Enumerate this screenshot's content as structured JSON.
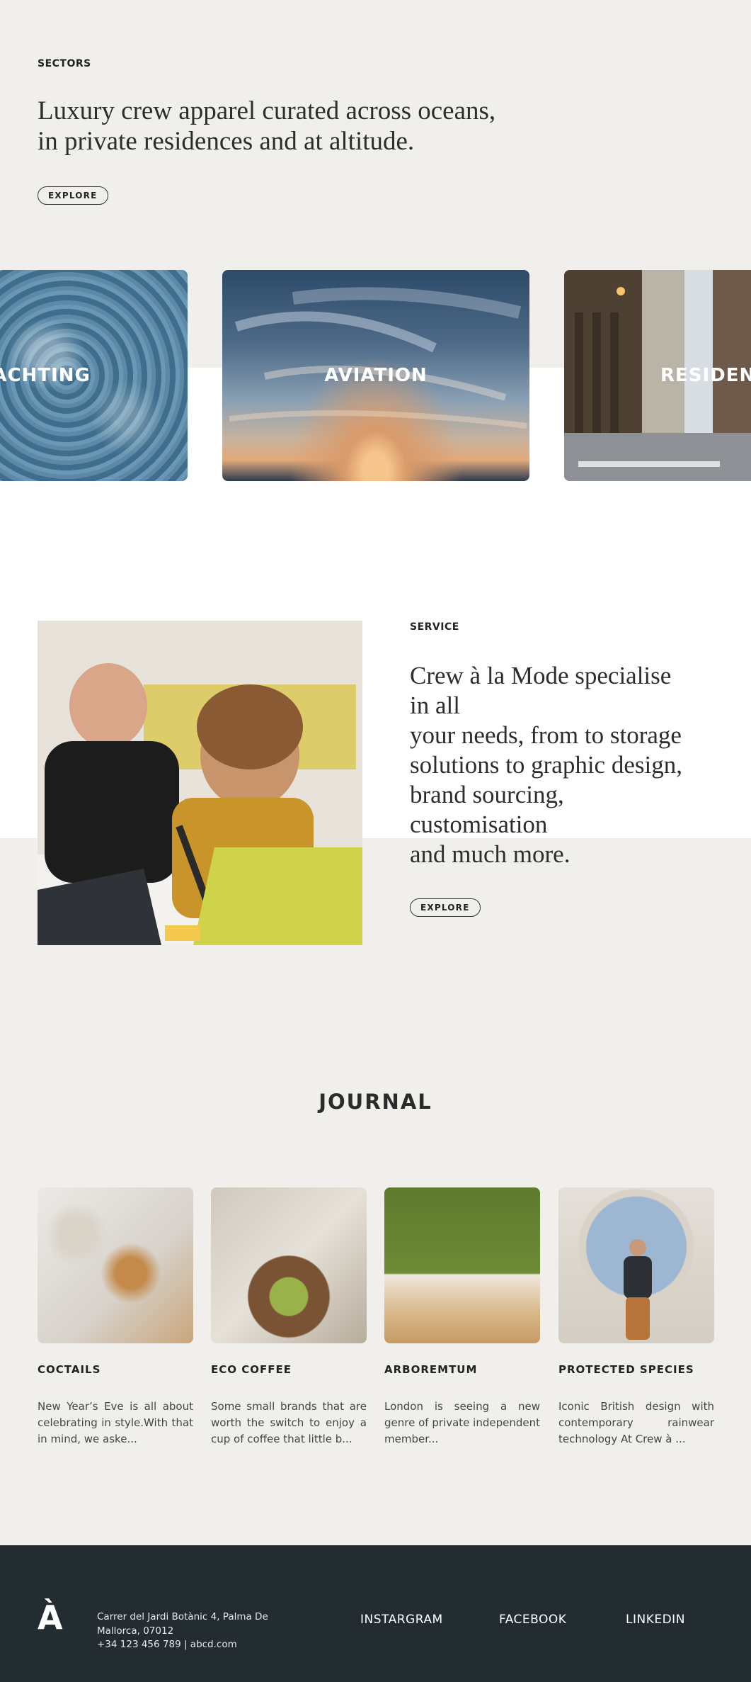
{
  "sectors": {
    "eyebrow": "SECTORS",
    "headline_line1": "Luxury crew apparel curated across oceans,",
    "headline_line2": "in private residences and at altitude.",
    "explore_label": "EXPLORE",
    "cards": [
      {
        "title": "YACHTING"
      },
      {
        "title": "AVIATION"
      },
      {
        "title": "RESIDENCES"
      }
    ]
  },
  "service": {
    "eyebrow": "SERVICE",
    "lines": [
      "Crew à la Mode specialise",
      "in all",
      "your needs, from to storage",
      "solutions to graphic design,",
      "brand sourcing,",
      "customisation",
      "and much more."
    ],
    "explore_label": "EXPLORE"
  },
  "journal": {
    "title": "JOURNAL",
    "posts": [
      {
        "title": "COCTAILS",
        "excerpt": "New Year’s Eve is all about celebrating in style.With that in mind, we aske..."
      },
      {
        "title": "ECO COFFEE",
        "excerpt": "Some small brands that are worth the switch to enjoy a cup of coffee that little b..."
      },
      {
        "title": "ARBOREMTUM",
        "excerpt": "London is seeing a new genre of private independent member..."
      },
      {
        "title": "PROTECTED SPECIES",
        "excerpt": "Iconic British design with contemporary rainwear technology At Crew à ..."
      }
    ]
  },
  "footer": {
    "logo": "À",
    "address_line1": "Carrer del Jardi Botànic 4, Palma De",
    "address_line2": "Mallorca, 07012",
    "contact": "+34 123 456 789 | abcd.com",
    "links": [
      "INSTARGRAM",
      "FACEBOOK",
      "LINKEDIN"
    ]
  },
  "colors": {
    "background": "#f0efeb",
    "white_band": "#ffffff",
    "footer": "#232d31",
    "text": "#2d2d2d"
  }
}
